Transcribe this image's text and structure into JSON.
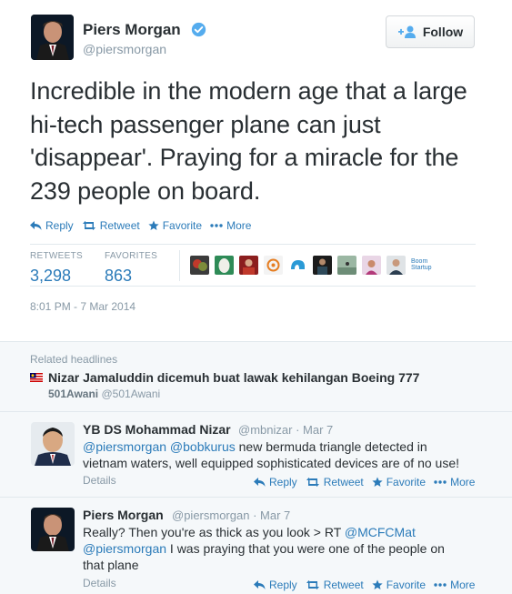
{
  "colors": {
    "link": "#2b7bb9",
    "muted": "#8899a6",
    "text": "#292f33",
    "verified": "#55acee"
  },
  "tweet": {
    "name": "Piers Morgan",
    "handle": "@piersmorgan",
    "follow_label": "Follow",
    "text": "Incredible in the modern age that a large hi-tech passenger plane can just 'disappear'. Praying for a miracle for the 239 people on board.",
    "actions": {
      "reply": "Reply",
      "retweet": "Retweet",
      "favorite": "Favorite",
      "more": "More"
    },
    "stats": {
      "retweets_label": "RETWEETS",
      "retweets": "3,298",
      "favorites_label": "FAVORITES",
      "favorites": "863"
    },
    "timestamp": "8:01 PM - 7 Mar 2014"
  },
  "related": {
    "label": "Related headlines",
    "title": "Nizar Jamaluddin dicemuh buat lawak kehilangan Boeing 777",
    "source_name": "501Awani",
    "source_handle": "@501Awani"
  },
  "replies": [
    {
      "name": "YB DS Mohammad Nizar",
      "handle": "@mbnizar",
      "dot": "·",
      "date": "Mar 7",
      "mention1": "@piersmorgan",
      "mention2": "@bobkurus",
      "text_line1": " new bermuda triangle detected in",
      "text_line2": "vietnam waters, well equipped  sophisticated devices are of no use!",
      "details": "Details"
    },
    {
      "name": "Piers Morgan",
      "handle": "@piersmorgan",
      "dot": "·",
      "date": "Mar 7",
      "text_line1": "Really? Then you're as thick as you look > RT ",
      "mention1": "@MCFCMat",
      "mention2": "@piersmorgan",
      "text_line2": "  I was praying that you were one of the people on",
      "text_line3": "that plane",
      "details": "Details"
    }
  ],
  "boom_startup": "Boom Startup"
}
